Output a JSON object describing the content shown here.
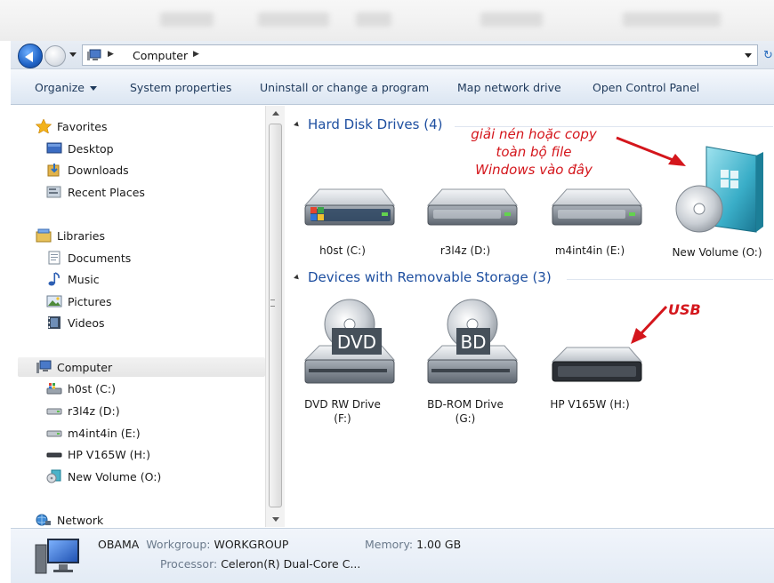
{
  "address": {
    "crumb": "Computer"
  },
  "toolbar": {
    "organize": "Organize",
    "system_properties": "System properties",
    "uninstall": "Uninstall or change a program",
    "map_network": "Map network drive",
    "control_panel": "Open Control Panel"
  },
  "nav": {
    "favorites": "Favorites",
    "desktop": "Desktop",
    "downloads": "Downloads",
    "recent": "Recent Places",
    "libraries": "Libraries",
    "documents": "Documents",
    "music": "Music",
    "pictures": "Pictures",
    "videos": "Videos",
    "computer": "Computer",
    "drive_c": "h0st (C:)",
    "drive_d": "r3l4z (D:)",
    "drive_e": "m4int4in (E:)",
    "drive_h": "HP V165W (H:)",
    "drive_o": "New Volume (O:)",
    "network": "Network"
  },
  "content": {
    "hdd_header": "Hard Disk Drives (4)",
    "removable_header": "Devices with Removable Storage (3)",
    "hdd": [
      "h0st (C:)",
      "r3l4z (D:)",
      "m4int4in (E:)",
      "New Volume (O:)"
    ],
    "removable": [
      {
        "line1": "DVD RW Drive",
        "line2": "(F:)",
        "badge": "DVD"
      },
      {
        "line1": "BD-ROM Drive",
        "line2": "(G:)",
        "badge": "BD"
      },
      {
        "line1": "HP V165W (H:)",
        "line2": ""
      }
    ]
  },
  "annotations": {
    "copy_line1": "giải nén hoặc copy",
    "copy_line2": "toàn bộ file",
    "copy_line3": "Windows vào đây",
    "usb": "USB"
  },
  "details": {
    "name": "OBAMA",
    "workgroup_label": "Workgroup:",
    "workgroup": "WORKGROUP",
    "memory_label": "Memory:",
    "memory": "1.00 GB",
    "processor_label": "Processor:",
    "processor": "Celeron(R) Dual-Core C..."
  },
  "colors": {
    "accent": "#1e4fa0",
    "annotation": "#d4161c"
  }
}
